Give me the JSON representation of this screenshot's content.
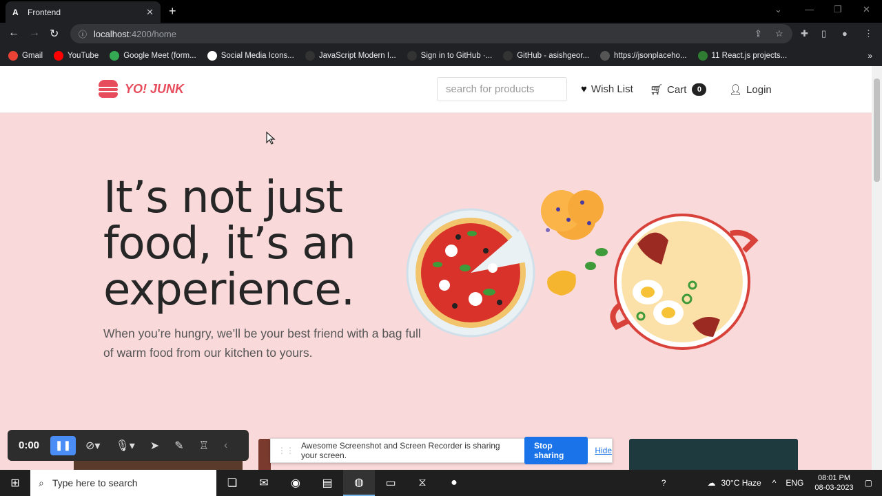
{
  "browser": {
    "tab_title": "Frontend",
    "url_host": "localhost",
    "url_path": ":4200/home",
    "bookmarks": [
      {
        "label": "Gmail",
        "color": "#ea4335"
      },
      {
        "label": "YouTube",
        "color": "#ff0000"
      },
      {
        "label": "Google Meet (form...",
        "color": "#34a853"
      },
      {
        "label": "Social Media Icons...",
        "color": "#ffffff"
      },
      {
        "label": "JavaScript Modern I...",
        "color": "#333333"
      },
      {
        "label": "Sign in to GitHub ·...",
        "color": "#333333"
      },
      {
        "label": "GitHub - asishgeor...",
        "color": "#333333"
      },
      {
        "label": "https://jsonplaceho...",
        "color": "#555555"
      },
      {
        "label": "11 React.js projects...",
        "color": "#2e7d32"
      }
    ]
  },
  "site": {
    "brand": "YO! JUNK",
    "brand_color": "#e74c5c",
    "search_placeholder": "search for products",
    "wishlist_label": "Wish List",
    "cart_label": "Cart",
    "cart_count": "0",
    "login_label": "Login"
  },
  "hero": {
    "headline": "It’s not just food, it’s an experience.",
    "subline": "When you’re hungry, we’ll be your best friend with a bag full of warm food from our kitchen to yours.",
    "background": "#f9d9d9"
  },
  "recorder": {
    "time": "0:00",
    "share_message": "Awesome Screenshot and Screen Recorder is sharing your screen.",
    "stop_label": "Stop sharing",
    "hide_label": "Hide"
  },
  "taskbar": {
    "search_placeholder": "Type here to search",
    "weather": "30°C  Haze",
    "language": "ENG",
    "time": "08:01 PM",
    "date": "08-03-2023"
  }
}
